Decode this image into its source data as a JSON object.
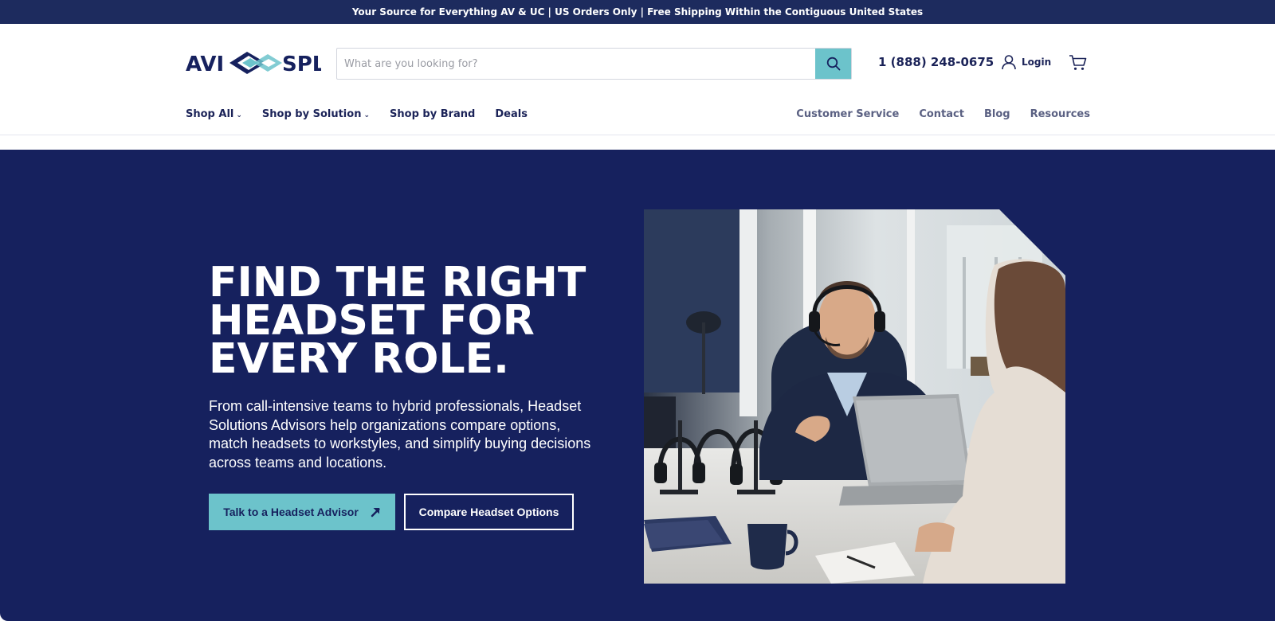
{
  "announcement": "Your Source for Everything AV & UC | US Orders Only | Free Shipping Within the Contiguous United States",
  "header": {
    "logo": {
      "left": "AVI",
      "right": "SPL"
    },
    "search": {
      "placeholder": "What are you looking for?",
      "value": "",
      "icon": "search-icon"
    },
    "phone": "1 (888) 248-0675",
    "login_label": "Login",
    "login_icon": "user-icon",
    "cart_icon": "cart-icon"
  },
  "nav": {
    "left": [
      {
        "label": "Shop All",
        "dropdown": true
      },
      {
        "label": "Shop by Solution",
        "dropdown": true
      },
      {
        "label": "Shop by Brand",
        "dropdown": false
      },
      {
        "label": "Deals",
        "dropdown": false
      }
    ],
    "right": [
      "Customer Service",
      "Contact",
      "Blog",
      "Resources"
    ]
  },
  "hero": {
    "headline_lines": [
      "FIND THE RIGHT",
      "HEADSET FOR",
      "EVERY ROLE."
    ],
    "description": "From call-intensive teams to hybrid professionals, Headset Solutions Advisors help organizations compare options, match headsets to workstyles, and simplify buying decisions across teams and locations.",
    "primary_cta": "Talk to a Headset Advisor",
    "primary_cta_icon": "arrow-up-right-icon",
    "secondary_cta": "Compare Headset Options"
  },
  "colors": {
    "navy": "#16215e",
    "teal": "#6cc3cb",
    "announcement_bg": "#1d2b5e",
    "nav_muted": "#5a6082"
  }
}
